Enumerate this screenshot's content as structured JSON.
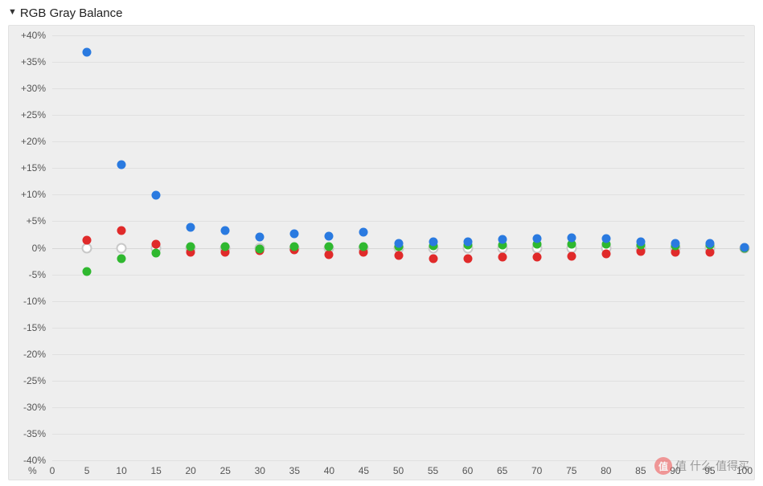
{
  "header": {
    "title": "RGB Gray Balance",
    "disclosure_icon": "▼"
  },
  "colors": {
    "red": "#e02a2a",
    "green": "#2fb82f",
    "blue": "#2a7ae0",
    "reference_stroke": "#c8c8c8",
    "reference_fill": "#ffffff",
    "grid": "#e0e0e0",
    "bg": "#eeeeee"
  },
  "watermark": {
    "logo_char": "值",
    "prefix": "值",
    "middle": "什么",
    "suffix": "值得买"
  },
  "chart_data": {
    "type": "scatter",
    "title": "RGB Gray Balance",
    "xlabel": "%",
    "ylabel": "",
    "xlim": [
      0,
      100
    ],
    "ylim": [
      -40,
      40
    ],
    "x_ticks": [
      0,
      5,
      10,
      15,
      20,
      25,
      30,
      35,
      40,
      45,
      50,
      55,
      60,
      65,
      70,
      75,
      80,
      85,
      90,
      95,
      100
    ],
    "y_ticks": [
      -40,
      -35,
      -30,
      -25,
      -20,
      -15,
      -10,
      -5,
      0,
      5,
      10,
      15,
      20,
      25,
      30,
      35,
      40
    ],
    "y_tick_labels": [
      "-40%",
      "-35%",
      "-30%",
      "-25%",
      "-20%",
      "-15%",
      "-10%",
      "-5%",
      "0%",
      "+5%",
      "+10%",
      "+15%",
      "+20%",
      "+25%",
      "+30%",
      "+35%",
      "+40%"
    ],
    "x": [
      5,
      10,
      15,
      20,
      25,
      30,
      35,
      40,
      45,
      50,
      55,
      60,
      65,
      70,
      75,
      80,
      85,
      90,
      95,
      100
    ],
    "series": [
      {
        "name": "Reference",
        "color_key": "reference",
        "values": [
          0,
          0,
          0,
          0,
          0,
          0,
          0,
          0,
          0,
          0,
          0,
          0,
          0,
          0,
          0,
          0,
          0,
          0,
          0,
          0
        ]
      },
      {
        "name": "Red",
        "color_key": "red",
        "values": [
          1.5,
          3.2,
          0.7,
          -0.8,
          -0.9,
          -0.6,
          -0.4,
          -1.3,
          -0.9,
          -1.5,
          -2.1,
          -2.0,
          -1.8,
          -1.7,
          -1.6,
          -1.1,
          -0.7,
          -0.9,
          -0.8,
          0.0
        ]
      },
      {
        "name": "Green",
        "color_key": "green",
        "values": [
          -4.5,
          -2.1,
          -1.0,
          0.2,
          0.2,
          -0.2,
          0.3,
          0.3,
          0.2,
          0.3,
          0.4,
          0.5,
          0.5,
          0.7,
          0.7,
          0.7,
          0.6,
          0.4,
          0.5,
          0.0
        ]
      },
      {
        "name": "Blue",
        "color_key": "blue",
        "values": [
          36.8,
          15.6,
          9.9,
          3.9,
          3.2,
          2.1,
          2.6,
          2.2,
          2.9,
          0.9,
          1.1,
          1.2,
          1.6,
          1.8,
          1.9,
          1.8,
          1.1,
          0.9,
          0.9,
          0.1
        ]
      }
    ]
  }
}
